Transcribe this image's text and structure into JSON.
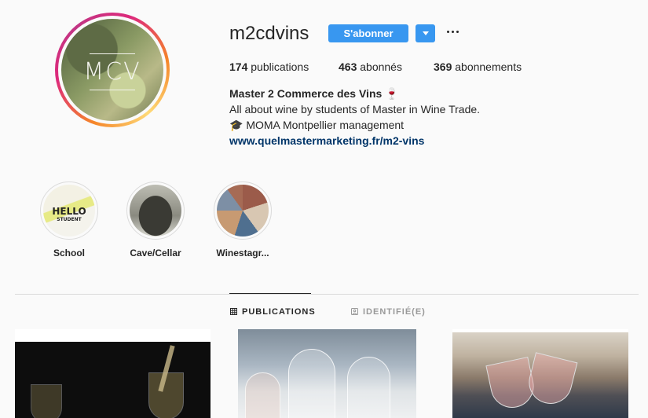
{
  "profile": {
    "username": "m2cdvins",
    "avatar_monogram": "MCV",
    "follow_label": "S'abonner",
    "accent_color": "#3897f0",
    "icons": [
      "chevron-down-icon",
      "more-options-icon"
    ]
  },
  "stats": [
    {
      "count": "174",
      "label": "publications"
    },
    {
      "count": "463",
      "label": "abonnés"
    },
    {
      "count": "369",
      "label": "abonnements"
    }
  ],
  "bio": {
    "name": "Master 2 Commerce des Vins 🍷",
    "line1": "All about wine by students of Master in Wine Trade.",
    "line2": "🎓 MOMA Montpellier management",
    "link": "www.quelmastermarketing.fr/m2-vins"
  },
  "highlights": [
    {
      "label": "School"
    },
    {
      "label": "Cave/Cellar"
    },
    {
      "label": "Winestagr..."
    }
  ],
  "tabs": [
    {
      "label": "PUBLICATIONS",
      "icon": "grid-icon",
      "active": true
    },
    {
      "label": "IDENTIFIÉ(E)",
      "icon": "tagged-icon",
      "active": false
    }
  ],
  "highlight_image_text": {
    "hello": "HELLO",
    "student": "STUDENT"
  }
}
